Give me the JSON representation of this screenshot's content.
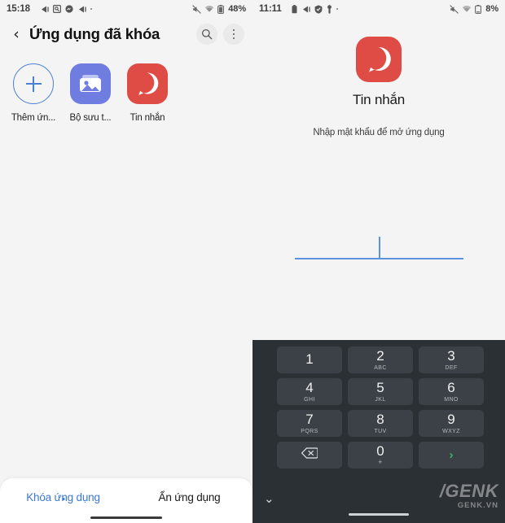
{
  "left_panel": {
    "status_bar": {
      "clock": "15:18",
      "icons": [
        "play-triangle-icon",
        "screenshot-icon",
        "messenger-icon",
        "play-triangle-icon",
        "dot-icon"
      ],
      "right_icons": [
        "mute-icon",
        "wifi-icon",
        "battery-icon"
      ],
      "battery_percent": "48%"
    },
    "action_bar": {
      "back_label": "‹",
      "title": "Ứng dụng đã khóa",
      "search_icon": "search-icon",
      "menu_icon": "kebab-menu-icon"
    },
    "apps": [
      {
        "label": "Thêm ứn...",
        "icon": "add-app-icon",
        "color": "#4a7fd4"
      },
      {
        "label": "Bộ sưu t...",
        "icon": "gallery-icon",
        "color": "#6f7de0"
      },
      {
        "label": "Tin nhắn",
        "icon": "messages-v-icon",
        "color": "#df4c45"
      }
    ],
    "tabs": [
      {
        "label": "Khóa ứng dụng",
        "active": true
      },
      {
        "label": "Ẩn ứng dụng",
        "active": false
      }
    ]
  },
  "right_panel": {
    "status_bar": {
      "clock": "11:11",
      "icons": [
        "battery-saver-icon",
        "play-triangle-icon",
        "shield-icon",
        "key-icon",
        "dot-icon"
      ],
      "right_icons": [
        "mute-icon",
        "wifi-icon",
        "battery-icon"
      ],
      "battery_percent": "8%"
    },
    "lock_screen": {
      "app_icon": "messages-v-icon",
      "app_name": "Tin nhắn",
      "hint": "Nhập mật khẩu để mở ứng dụng",
      "password_value": "",
      "password_placeholder": ""
    },
    "keypad": {
      "keys": [
        {
          "num": "1",
          "sub": ""
        },
        {
          "num": "2",
          "sub": "ABC"
        },
        {
          "num": "3",
          "sub": "DEF"
        },
        {
          "num": "4",
          "sub": "GHI"
        },
        {
          "num": "5",
          "sub": "JKL"
        },
        {
          "num": "6",
          "sub": "MNO"
        },
        {
          "num": "7",
          "sub": "PQRS"
        },
        {
          "num": "8",
          "sub": "TUV"
        },
        {
          "num": "9",
          "sub": "WXYZ"
        }
      ],
      "backspace_icon": "backspace-icon",
      "zero": {
        "num": "0",
        "sub": "+"
      },
      "enter_icon": "chevron-right-icon",
      "enter_color": "#39b56a",
      "collapse_icon": "chevron-down-icon"
    }
  },
  "watermark": {
    "main": "/GENK",
    "sub": "GENK.VN"
  }
}
